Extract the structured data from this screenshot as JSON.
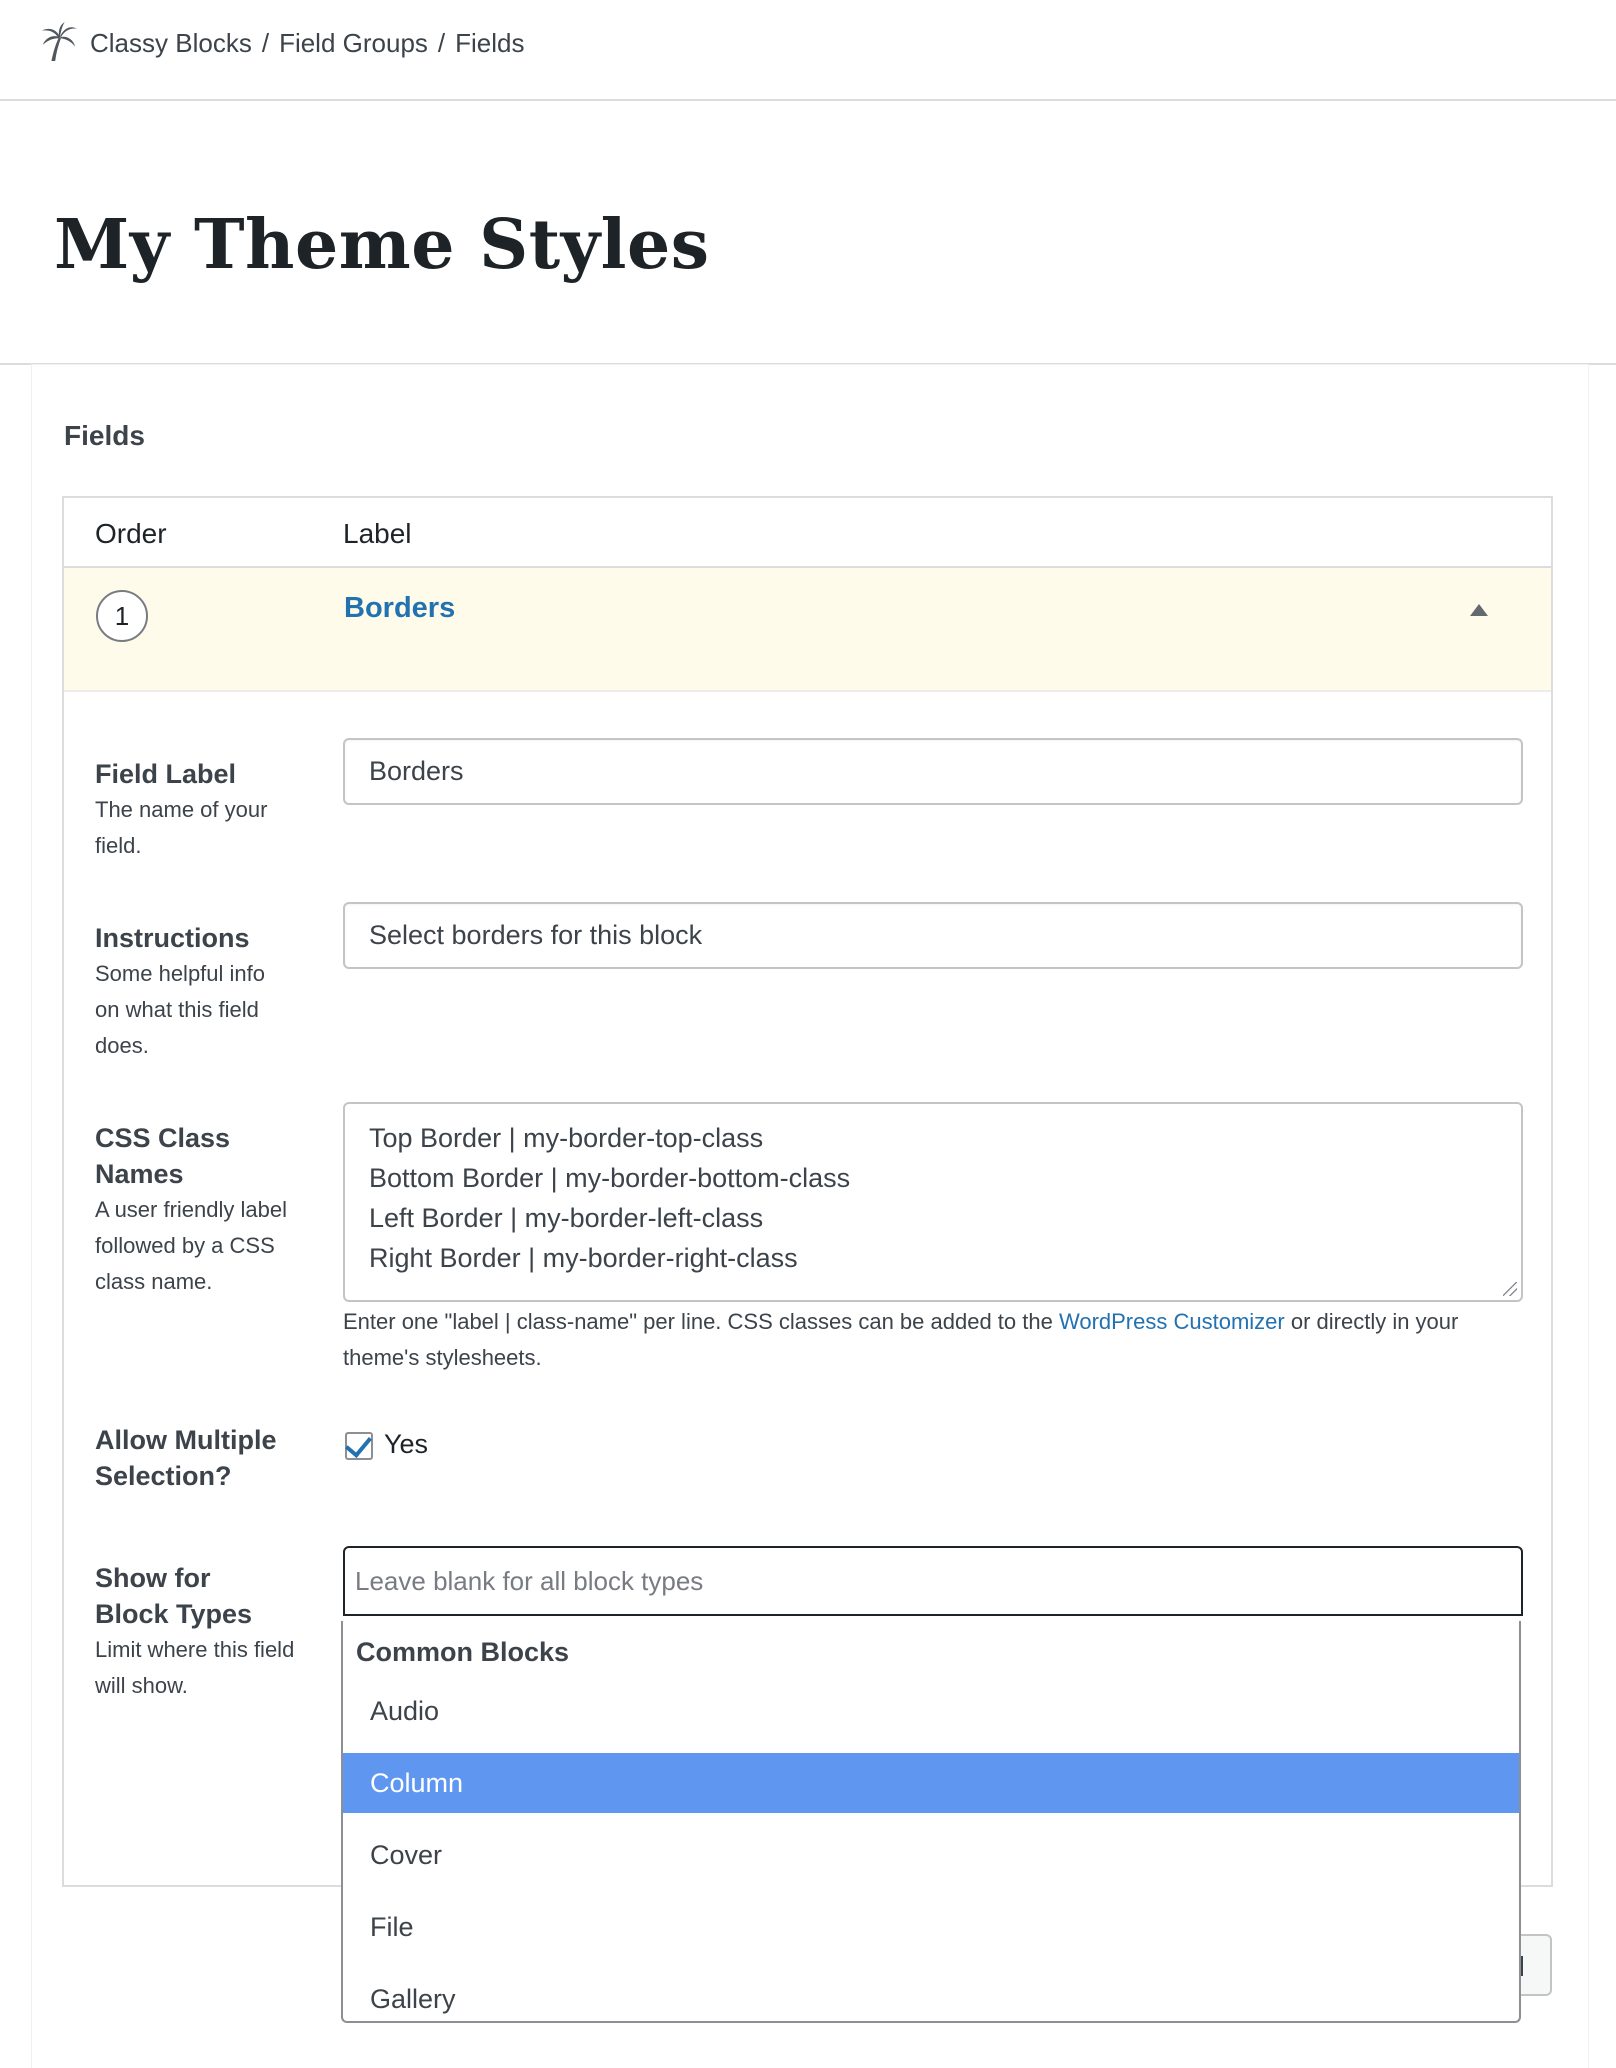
{
  "breadcrumb": {
    "items": [
      "Classy Blocks",
      "Field Groups",
      "Fields"
    ],
    "separator": "/"
  },
  "page": {
    "title": "My Theme Styles",
    "section_title": "Fields"
  },
  "table": {
    "columns": [
      "Order",
      "Label"
    ],
    "rows": [
      {
        "order": "1",
        "label": "Borders",
        "expanded": true
      }
    ]
  },
  "field_settings": {
    "field_label": {
      "label": "Field Label",
      "description": "The name of your field.",
      "value": "Borders"
    },
    "instructions": {
      "label": "Instructions",
      "description": "Some helpful info on what this field does.",
      "value": "Select borders for this block"
    },
    "css_class_names": {
      "label": "CSS Class Names",
      "description": "A user friendly label followed by a CSS class name.",
      "lines": [
        "Top Border | my-border-top-class",
        "Bottom Border | my-border-bottom-class",
        "Left Border | my-border-left-class",
        "Right Border | my-border-right-class"
      ],
      "help_before": "Enter one \"label | class-name\" per line. CSS classes can be added to the ",
      "help_link": "WordPress Customizer",
      "help_after": " or directly in your theme's stylesheets."
    },
    "allow_multiple": {
      "label": "Allow Multiple Selection?",
      "checked": true,
      "option_label": "Yes"
    },
    "show_for_block_types": {
      "label": "Show for Block Types",
      "description": "Limit where this field will show.",
      "placeholder": "Leave blank for all block types",
      "dropdown": {
        "group": "Common Blocks",
        "options": [
          "Audio",
          "Column",
          "Cover",
          "File",
          "Gallery"
        ],
        "highlighted": "Column"
      }
    }
  },
  "colors": {
    "link": "#2271b1",
    "row_highlight": "#fffbeb",
    "option_highlight": "#5f96f0"
  },
  "icons": {
    "logo": "palm-tree-icon",
    "row_toggle": "caret-up-icon",
    "checkbox": "check-icon"
  }
}
